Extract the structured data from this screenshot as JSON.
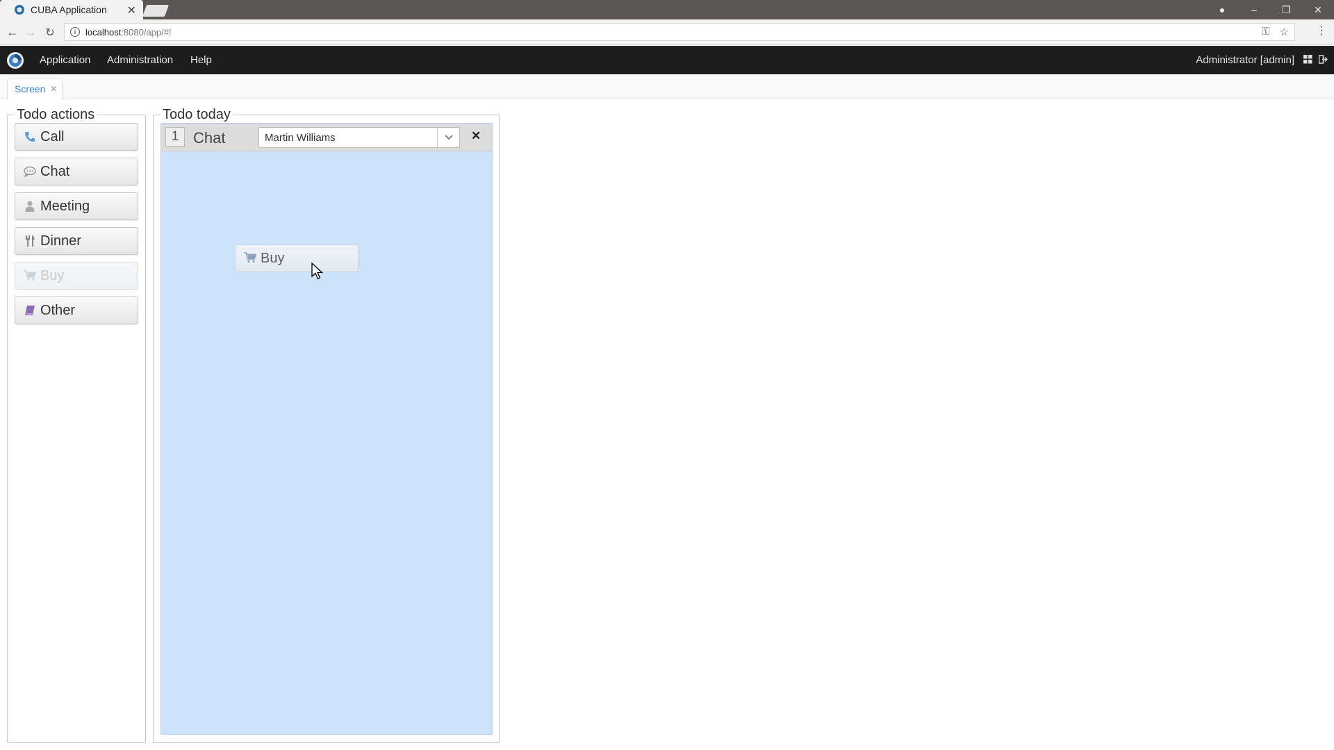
{
  "browser": {
    "tab_title": "CUBA Application",
    "url_host": "localhost",
    "url_path": ":8080/app/#!"
  },
  "appbar": {
    "menu": [
      "Application",
      "Administration",
      "Help"
    ],
    "user": "Administrator [admin]"
  },
  "screen_tab": "Screen",
  "todo_actions": {
    "title": "Todo actions",
    "buttons": [
      {
        "label": "Call",
        "icon": "phone-icon",
        "enabled": true
      },
      {
        "label": "Chat",
        "icon": "chat-bubble-icon",
        "enabled": true
      },
      {
        "label": "Meeting",
        "icon": "user-icon",
        "enabled": true
      },
      {
        "label": "Dinner",
        "icon": "cutlery-icon",
        "enabled": true
      },
      {
        "label": "Buy",
        "icon": "shopping-cart-icon",
        "enabled": false
      },
      {
        "label": "Other",
        "icon": "book-icon",
        "enabled": true
      }
    ]
  },
  "todo_today": {
    "title": "Todo today",
    "items": [
      {
        "number": "1",
        "type": "Chat",
        "person": "Martin Williams"
      }
    ],
    "dragging": {
      "label": "Buy",
      "icon": "shopping-cart-icon"
    }
  },
  "colors": {
    "accent": "#3b86c8",
    "dropzone": "#cce2fb",
    "appbar": "#1d1d1d"
  }
}
